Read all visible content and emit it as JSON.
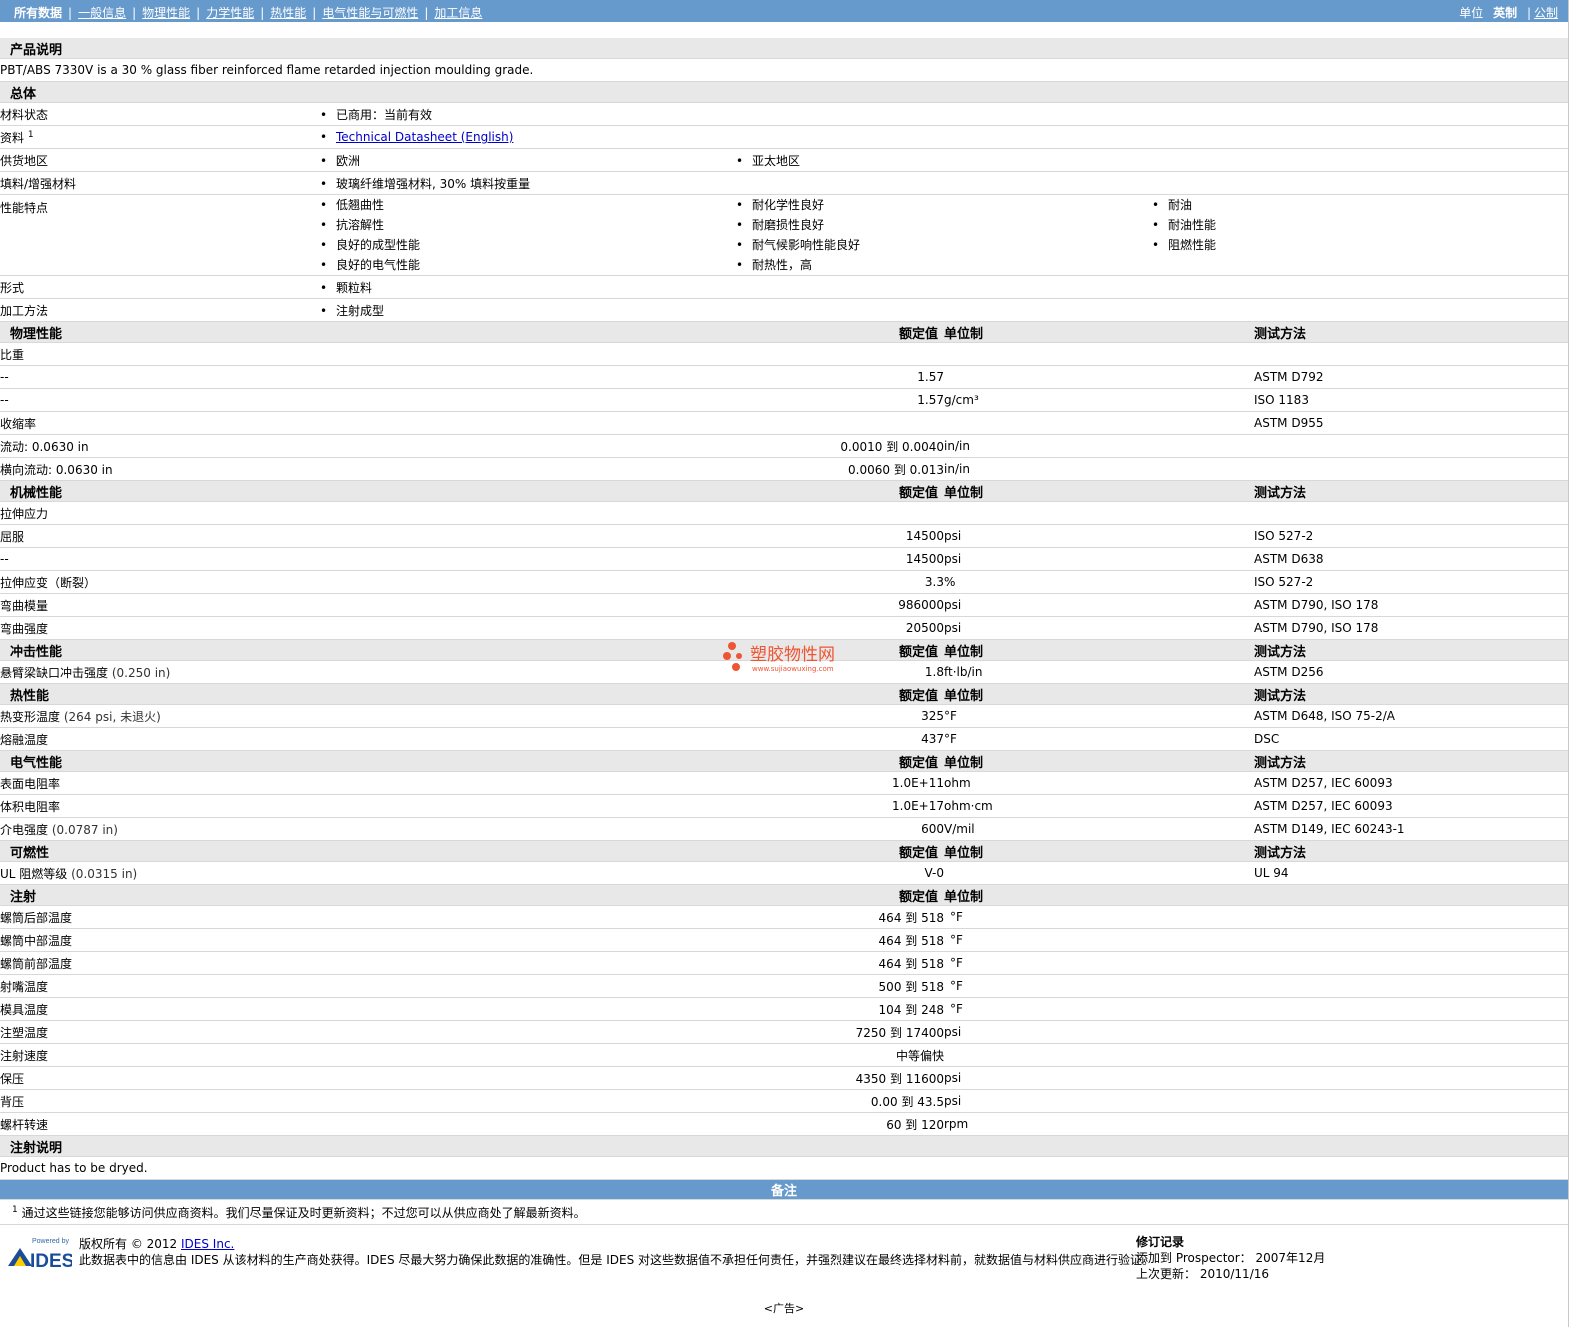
{
  "nav": {
    "items": [
      "所有数据",
      "一般信息",
      "物理性能",
      "力学性能",
      "热性能",
      "电气性能与可燃性",
      "加工信息"
    ],
    "units_label": "单位",
    "unit_english": "英制",
    "unit_metric": "公制"
  },
  "description": {
    "title": "产品说明",
    "text": "PBT/ABS 7330V is a 30 % glass fiber reinforced flame retarded injection moulding grade."
  },
  "general": {
    "title": "总体",
    "status_label": "材料状态",
    "status_value": "已商用：当前有效",
    "docs_label": "资料",
    "docs_sup": "1",
    "docs_link": "Technical Datasheet (English)",
    "region_label": "供货地区",
    "region_1": "欧洲",
    "region_2": "亚太地区",
    "filler_label": "填料/增强材料",
    "filler_value": "玻璃纤维增强材料, 30% 填料按重量",
    "features_label": "性能特点",
    "features_col1": [
      "低翘曲性",
      "抗溶解性",
      "良好的成型性能",
      "良好的电气性能"
    ],
    "features_col2": [
      "耐化学性良好",
      "耐磨损性良好",
      "耐气候影响性能良好",
      "耐热性，高"
    ],
    "features_col3": [
      "耐油",
      "耐油性能",
      "阻燃性能"
    ],
    "form_label": "形式",
    "form_value": "颗粒料",
    "process_label": "加工方法",
    "process_value": "注射成型"
  },
  "headers": {
    "nominal": "额定值",
    "unit": "单位制",
    "method": "测试方法"
  },
  "physical": {
    "title": "物理性能",
    "sg_label": "比重",
    "sg1": {
      "label": "--",
      "value": "1.57",
      "unit": "",
      "method": "ASTM D792"
    },
    "sg2": {
      "label": "--",
      "value": "1.57",
      "unit": "g/cm³",
      "method": "ISO 1183"
    },
    "shrink_label": "收缩率",
    "shrink_method": "ASTM D955",
    "shrink1": {
      "label": "流动: 0.0630 in",
      "value": "0.0010 到  0.0040",
      "unit": "in/in"
    },
    "shrink2": {
      "label": "横向流动: 0.0630 in",
      "value": "0.0060 到  0.013",
      "unit": "in/in"
    }
  },
  "mechanical": {
    "title": "机械性能",
    "tensile_label": "拉伸应力",
    "tensile1": {
      "label": "屈服",
      "value": "14500",
      "unit": "psi",
      "method": "ISO 527-2"
    },
    "tensile2": {
      "label": "--",
      "value": "14500",
      "unit": "psi",
      "method": "ASTM D638"
    },
    "strain": {
      "label": "拉伸应变（断裂）",
      "value": "3.3",
      "unit": "%",
      "method": "ISO 527-2"
    },
    "flexmod": {
      "label": "弯曲模量",
      "value": "986000",
      "unit": "psi",
      "method": "ASTM D790, ISO 178"
    },
    "flexstr": {
      "label": "弯曲强度",
      "value": "20500",
      "unit": "psi",
      "method": "ASTM D790, ISO 178"
    }
  },
  "impact": {
    "title": "冲击性能",
    "izod": {
      "label": "悬臂梁缺口冲击强度",
      "paren": "(0.250 in)",
      "value": "1.8",
      "unit": "ft·lb/in",
      "method": "ASTM D256"
    }
  },
  "thermal": {
    "title": "热性能",
    "hdt": {
      "label": "热变形温度",
      "paren": "(264 psi, 未退火)",
      "value": "325",
      "unit": "°F",
      "method": "ASTM D648, ISO 75-2/A"
    },
    "melt": {
      "label": "熔融温度",
      "value": "437",
      "unit": "°F",
      "method": "DSC"
    }
  },
  "electrical": {
    "title": "电气性能",
    "surf": {
      "label": "表面电阻率",
      "value": "1.0E+11",
      "unit": "ohm",
      "method": "ASTM D257, IEC 60093"
    },
    "vol": {
      "label": "体积电阻率",
      "value": "1.0E+17",
      "unit": "ohm·cm",
      "method": "ASTM D257, IEC 60093"
    },
    "diel": {
      "label": "介电强度",
      "paren": "(0.0787 in)",
      "value": "600",
      "unit": "V/mil",
      "method": "ASTM D149, IEC 60243-1"
    }
  },
  "flammability": {
    "title": "可燃性",
    "ul": {
      "label": "UL 阻燃等级",
      "paren": "(0.0315 in)",
      "value": "V-0",
      "unit": "",
      "method": "UL 94"
    }
  },
  "injection": {
    "title": "注射",
    "rows": [
      {
        "label": "螺筒后部温度",
        "value": "464 到  518",
        "unit": "°F"
      },
      {
        "label": "螺筒中部温度",
        "value": "464 到  518",
        "unit": "°F"
      },
      {
        "label": "螺筒前部温度",
        "value": "464 到  518",
        "unit": "°F"
      },
      {
        "label": "射嘴温度",
        "value": "500 到  518",
        "unit": "°F"
      },
      {
        "label": "模具温度",
        "value": "104 到  248",
        "unit": "°F"
      },
      {
        "label": "注塑温度",
        "value": "7250 到  17400",
        "unit": "psi"
      },
      {
        "label": "注射速度",
        "value": "中等偏快",
        "unit": ""
      },
      {
        "label": "保压",
        "value": "4350 到  11600",
        "unit": "psi"
      },
      {
        "label": "背压",
        "value": "0.00 到  43.5",
        "unit": "psi"
      },
      {
        "label": "螺杆转速",
        "value": "60 到  120",
        "unit": "rpm"
      }
    ]
  },
  "inj_notes": {
    "title": "注射说明",
    "text": "Product has to be dryed."
  },
  "remarks": {
    "title": "备注",
    "sup": "1",
    "text": "通过这些链接您能够访问供应商资料。我们尽量保证及时更新资料；不过您可以从供应商处了解最新资料。"
  },
  "footer": {
    "logo_top": "Powered by",
    "logo_text": "IDES",
    "copyright": "版权所有 © 2012",
    "company_link": "IDES Inc.",
    "disclaimer": "此数据表中的信息由 IDES 从该材料的生产商处获得。IDES 尽最大努力确保此数据的准确性。但是 IDES 对这些数据值不承担任何责任，并强烈建议在最终选择材料前，就数据值与材料供应商进行验证。",
    "rev_title": "修订记录",
    "added_label": "添加到 Prospector：",
    "added_value": "2007年12月",
    "updated_label": "上次更新：",
    "updated_value": "2010/11/16"
  },
  "watermark": {
    "text": "塑胶物性网",
    "url": "www.sujiaowuxing.com"
  },
  "ad_label": "<广告>",
  "colors": {
    "nav_bg": "#6699cc",
    "section_bg": "#e8e8e8",
    "link": "#0000cc"
  }
}
